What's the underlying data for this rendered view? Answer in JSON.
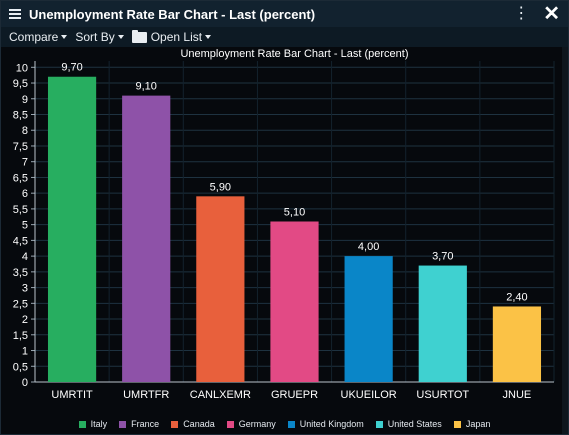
{
  "window": {
    "title": "Unemployment Rate Bar Chart - Last (percent)"
  },
  "toolbar": {
    "compare_label": "Compare",
    "sort_label": "Sort By",
    "open_list_label": "Open List"
  },
  "colors": {
    "Italy": "#27ae60",
    "France": "#8e52a8",
    "Canada": "#e8603c",
    "Germany": "#e24a85",
    "United Kingdom": "#0a86c8",
    "United States": "#3fd1d0",
    "Japan": "#fbc246"
  },
  "chart_data": {
    "type": "bar",
    "title": "Unemployment Rate Bar Chart - Last (percent)",
    "categories": [
      "UMRTIT",
      "UMRTFR",
      "CANLXEMR",
      "GRUEPR",
      "UKUEILOR",
      "USURTOT",
      "JNUE"
    ],
    "values": [
      9.7,
      9.1,
      5.9,
      5.1,
      4.0,
      3.7,
      2.4
    ],
    "value_labels": [
      "9,70",
      "9,10",
      "5,90",
      "5,10",
      "4,00",
      "3,70",
      "2,40"
    ],
    "series_names": [
      "Italy",
      "France",
      "Canada",
      "Germany",
      "United Kingdom",
      "United States",
      "Japan"
    ],
    "ylim": [
      0,
      10.2
    ],
    "yticks": [
      0,
      0.5,
      1,
      1.5,
      2,
      2.5,
      3,
      3.5,
      4,
      4.5,
      5,
      5.5,
      6,
      6.5,
      7,
      7.5,
      8,
      8.5,
      9,
      9.5,
      10
    ],
    "ytick_labels": [
      "0",
      "0,5",
      "1",
      "1,5",
      "2",
      "2,5",
      "3",
      "3,5",
      "4",
      "4,5",
      "5",
      "5,5",
      "6",
      "6,5",
      "7",
      "7,5",
      "8",
      "8,5",
      "9",
      "9,5",
      "10"
    ],
    "grid": true,
    "legend_position": "bottom"
  }
}
